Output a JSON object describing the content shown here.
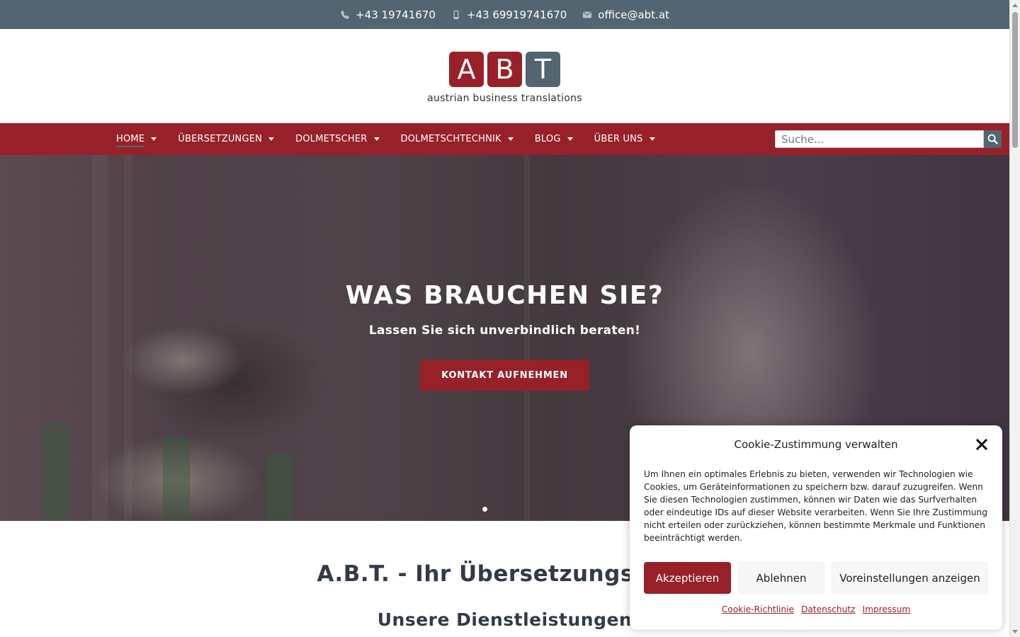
{
  "topbar": {
    "phone": "+43 19741670",
    "mobile": "+43 69919741670",
    "email": "office@abt.at"
  },
  "logo": {
    "letters": [
      "A",
      "B",
      "T"
    ],
    "tagline": "austrian business translations"
  },
  "nav": {
    "items": [
      {
        "label": "HOME"
      },
      {
        "label": "ÜBERSETZUNGEN"
      },
      {
        "label": "DOLMETSCHER"
      },
      {
        "label": "DOLMETSCHTECHNIK"
      },
      {
        "label": "BLOG"
      },
      {
        "label": "ÜBER UNS"
      }
    ],
    "search_placeholder": "Suche..."
  },
  "hero": {
    "title": "WAS BRAUCHEN SIE?",
    "subtitle": "Lassen Sie sich unverbindlich beraten!",
    "button": "KONTAKT AUFNEHMEN"
  },
  "content": {
    "heading": "A.B.T. - Ihr Übersetzungsbüro",
    "subheading": "Unsere Dienstleistungen"
  },
  "cookie": {
    "title": "Cookie-Zustimmung verwalten",
    "text": "Um Ihnen ein optimales Erlebnis zu bieten, verwenden wir Technologien wie Cookies, um Geräteinformationen zu speichern bzw. darauf zuzugreifen. Wenn Sie diesen Technologien zustimmen, können wir Daten wie das Surfverhalten oder eindeutige IDs auf dieser Website verarbeiten. Wenn Sie Ihre Zustimmung nicht erteilen oder zurückziehen, können bestimmte Merkmale und Funktionen beeinträchtigt werden.",
    "accept": "Akzeptieren",
    "deny": "Ablehnen",
    "preferences": "Voreinstellungen anzeigen",
    "links": [
      "Cookie-Richtlinie",
      "Datenschutz",
      "Impressum"
    ]
  },
  "colors": {
    "brand_red": "#982129",
    "brand_grey": "#526570"
  }
}
